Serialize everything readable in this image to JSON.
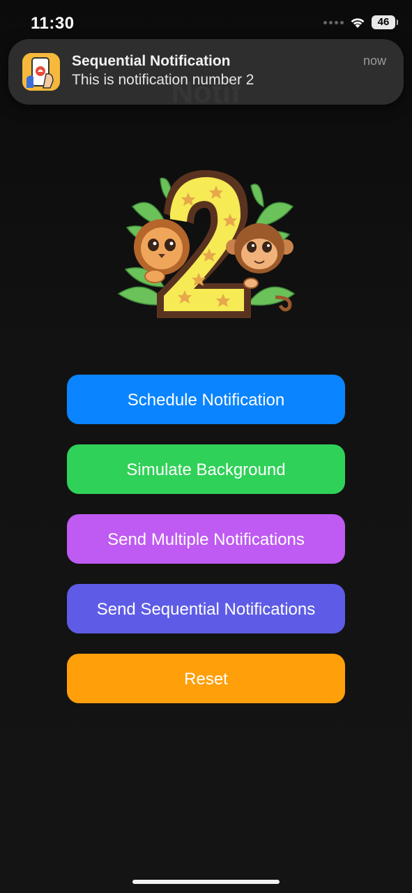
{
  "status_bar": {
    "time": "11:30",
    "battery": "46",
    "icons": [
      "cellular-signal-icon",
      "wifi-icon",
      "battery-icon"
    ]
  },
  "page": {
    "title": "Notif"
  },
  "notification": {
    "app_icon": "notification-app-icon",
    "title": "Sequential Notification",
    "body": "This is notification number 2",
    "time": "now"
  },
  "illustration": {
    "description_icon": "number-two-jungle-illustration"
  },
  "buttons": [
    {
      "label": "Schedule Notification",
      "color": "#0a84ff"
    },
    {
      "label": "Simulate Background",
      "color": "#30d158"
    },
    {
      "label": "Send Multiple Notifications",
      "color": "#bf5af2"
    },
    {
      "label": "Send Sequential Notifications",
      "color": "#5e5ce6"
    },
    {
      "label": "Reset",
      "color": "#ff9f0a"
    }
  ]
}
